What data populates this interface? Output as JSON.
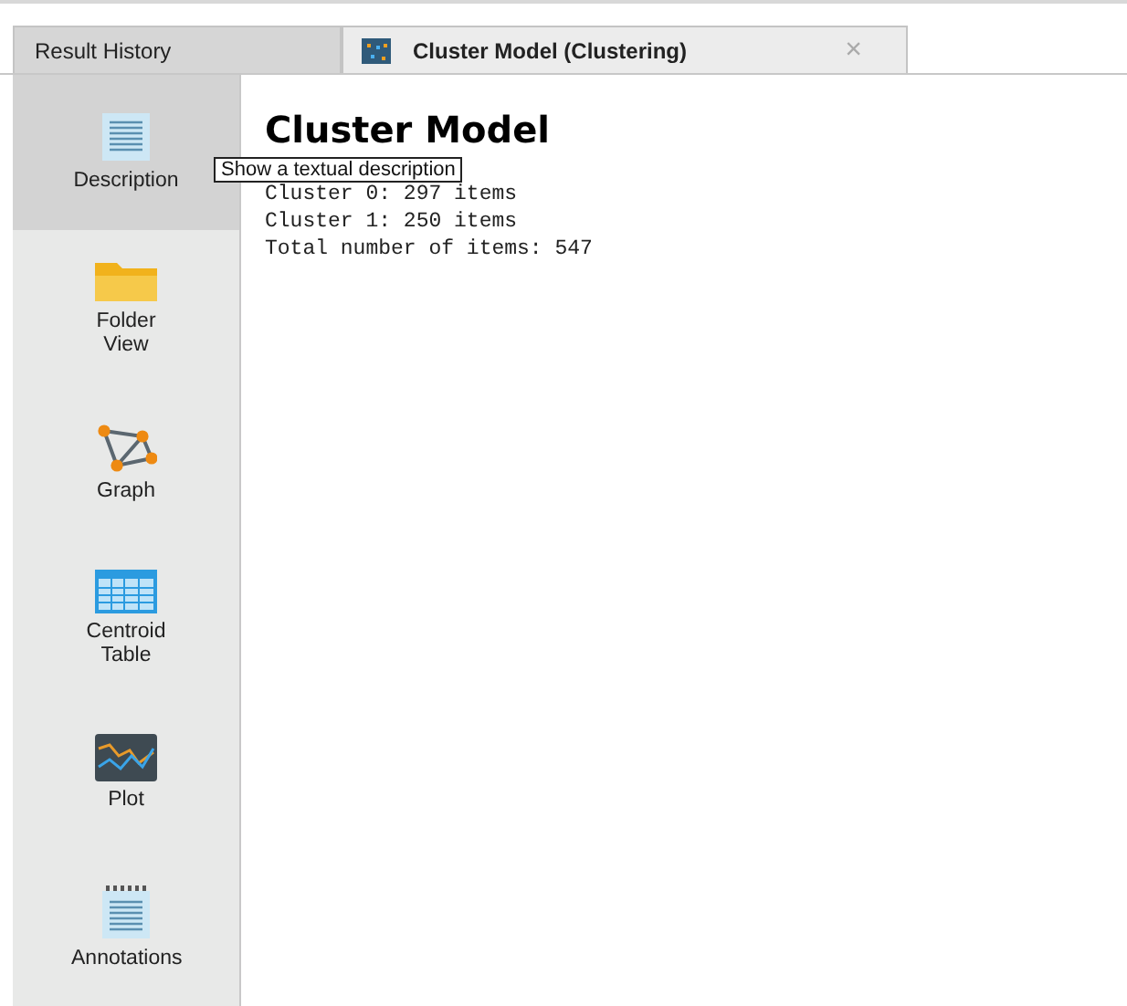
{
  "tabs": [
    {
      "label": "Result History",
      "selected": false
    },
    {
      "label": "Cluster Model (Clustering)",
      "selected": true,
      "close": "×"
    }
  ],
  "sidebar": {
    "items": [
      {
        "kind": "description",
        "label": "Description",
        "selected": true
      },
      {
        "kind": "folder",
        "label": "Folder View",
        "selected": false
      },
      {
        "kind": "graph",
        "label": "Graph",
        "selected": false
      },
      {
        "kind": "table",
        "label": "Centroid Table",
        "selected": false
      },
      {
        "kind": "plot",
        "label": "Plot",
        "selected": false
      },
      {
        "kind": "annotations",
        "label": "Annotations",
        "selected": false
      }
    ]
  },
  "tooltip": "Show a textual description",
  "content": {
    "title": "Cluster Model",
    "lines": [
      "Cluster 0: 297 items",
      "Cluster 1: 250 items",
      "Total number of items: 547"
    ]
  }
}
